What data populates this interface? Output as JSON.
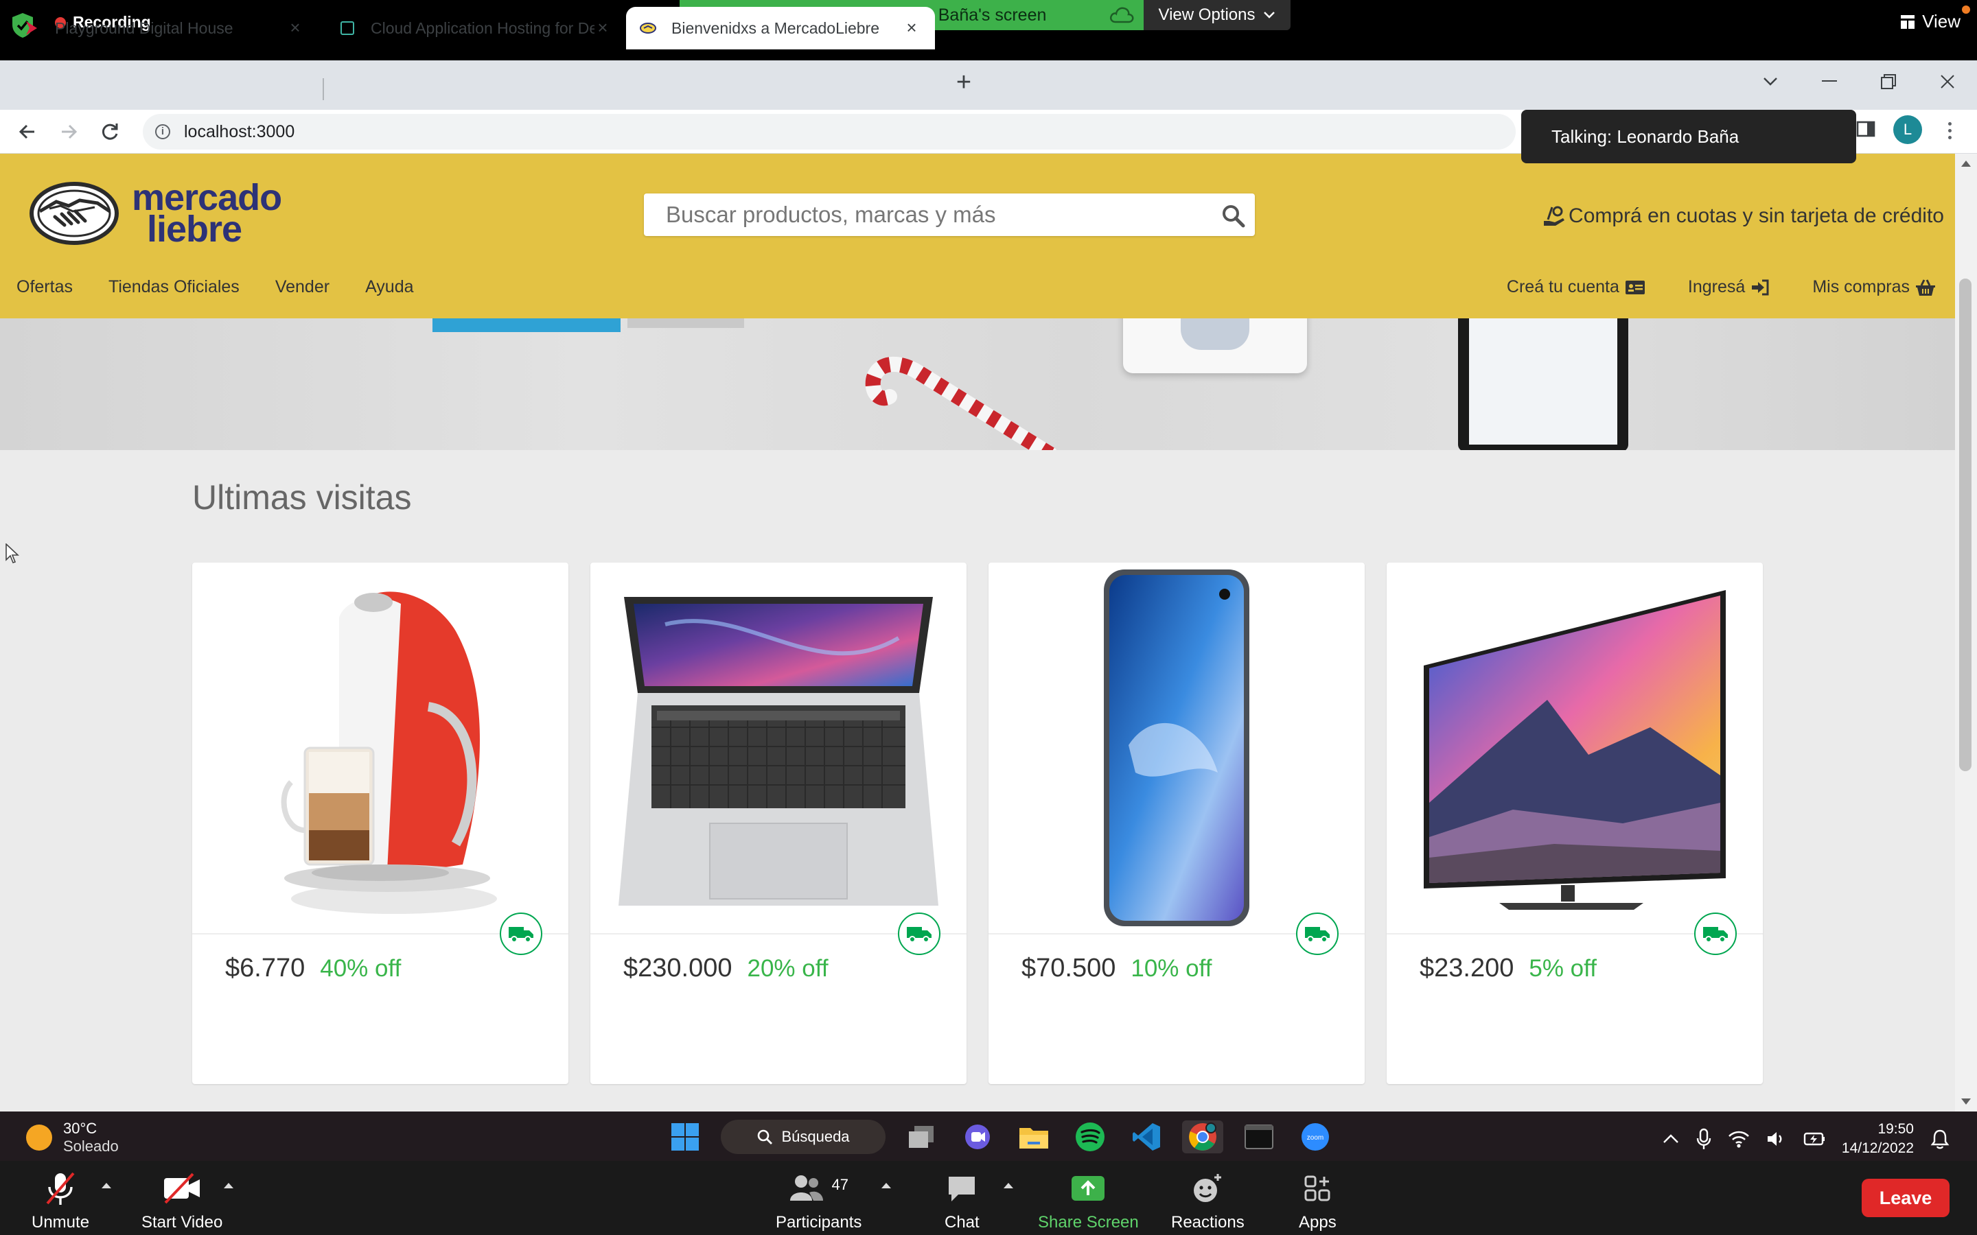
{
  "zoom_top": {
    "recording": "Recording",
    "viewing_banner": "You are viewing Leonardo Baña's screen",
    "view_options": "View Options",
    "view": "View"
  },
  "browser": {
    "tabs": [
      {
        "title": "Playground Digital House"
      },
      {
        "title": "Cloud Application Hosting for De"
      },
      {
        "title": "Bienvenidxs a MercadoLiebre"
      }
    ],
    "new_tab": "+",
    "url": "localhost:3000",
    "profile_initial": "L"
  },
  "talking_popup": "Talking: Leonardo Baña",
  "site": {
    "logo_line1": "mercado",
    "logo_line2": "liebre",
    "search_placeholder": "Buscar productos, marcas y más",
    "promo": "Comprá en cuotas y sin tarjeta de crédito",
    "main_nav": [
      "Ofertas",
      "Tiendas Oficiales",
      "Vender",
      "Ayuda"
    ],
    "user_nav": [
      "Creá tu cuenta",
      "Ingresá",
      "Mis compras"
    ],
    "section_title": "Ultimas visitas",
    "products": [
      {
        "price": "$6.770",
        "discount": "40% off"
      },
      {
        "price": "$230.000",
        "discount": "20% off"
      },
      {
        "price": "$70.500",
        "discount": "10% off"
      },
      {
        "price": "$23.200",
        "discount": "5% off"
      }
    ]
  },
  "taskbar": {
    "temp": "30°C",
    "condition": "Soleado",
    "search": "Búsqueda",
    "time": "19:50",
    "date": "14/12/2022"
  },
  "zoom_bottom": {
    "unmute": "Unmute",
    "start_video": "Start Video",
    "participants_count": "47",
    "participants": "Participants",
    "chat": "Chat",
    "share_screen": "Share Screen",
    "reactions": "Reactions",
    "apps": "Apps",
    "leave": "Leave"
  },
  "colors": {
    "ml_yellow": "#e3c244",
    "ml_blue": "#2d3277",
    "discount_green": "#39b54a",
    "zoom_green": "#3db14a",
    "leave_red": "#e02828"
  }
}
